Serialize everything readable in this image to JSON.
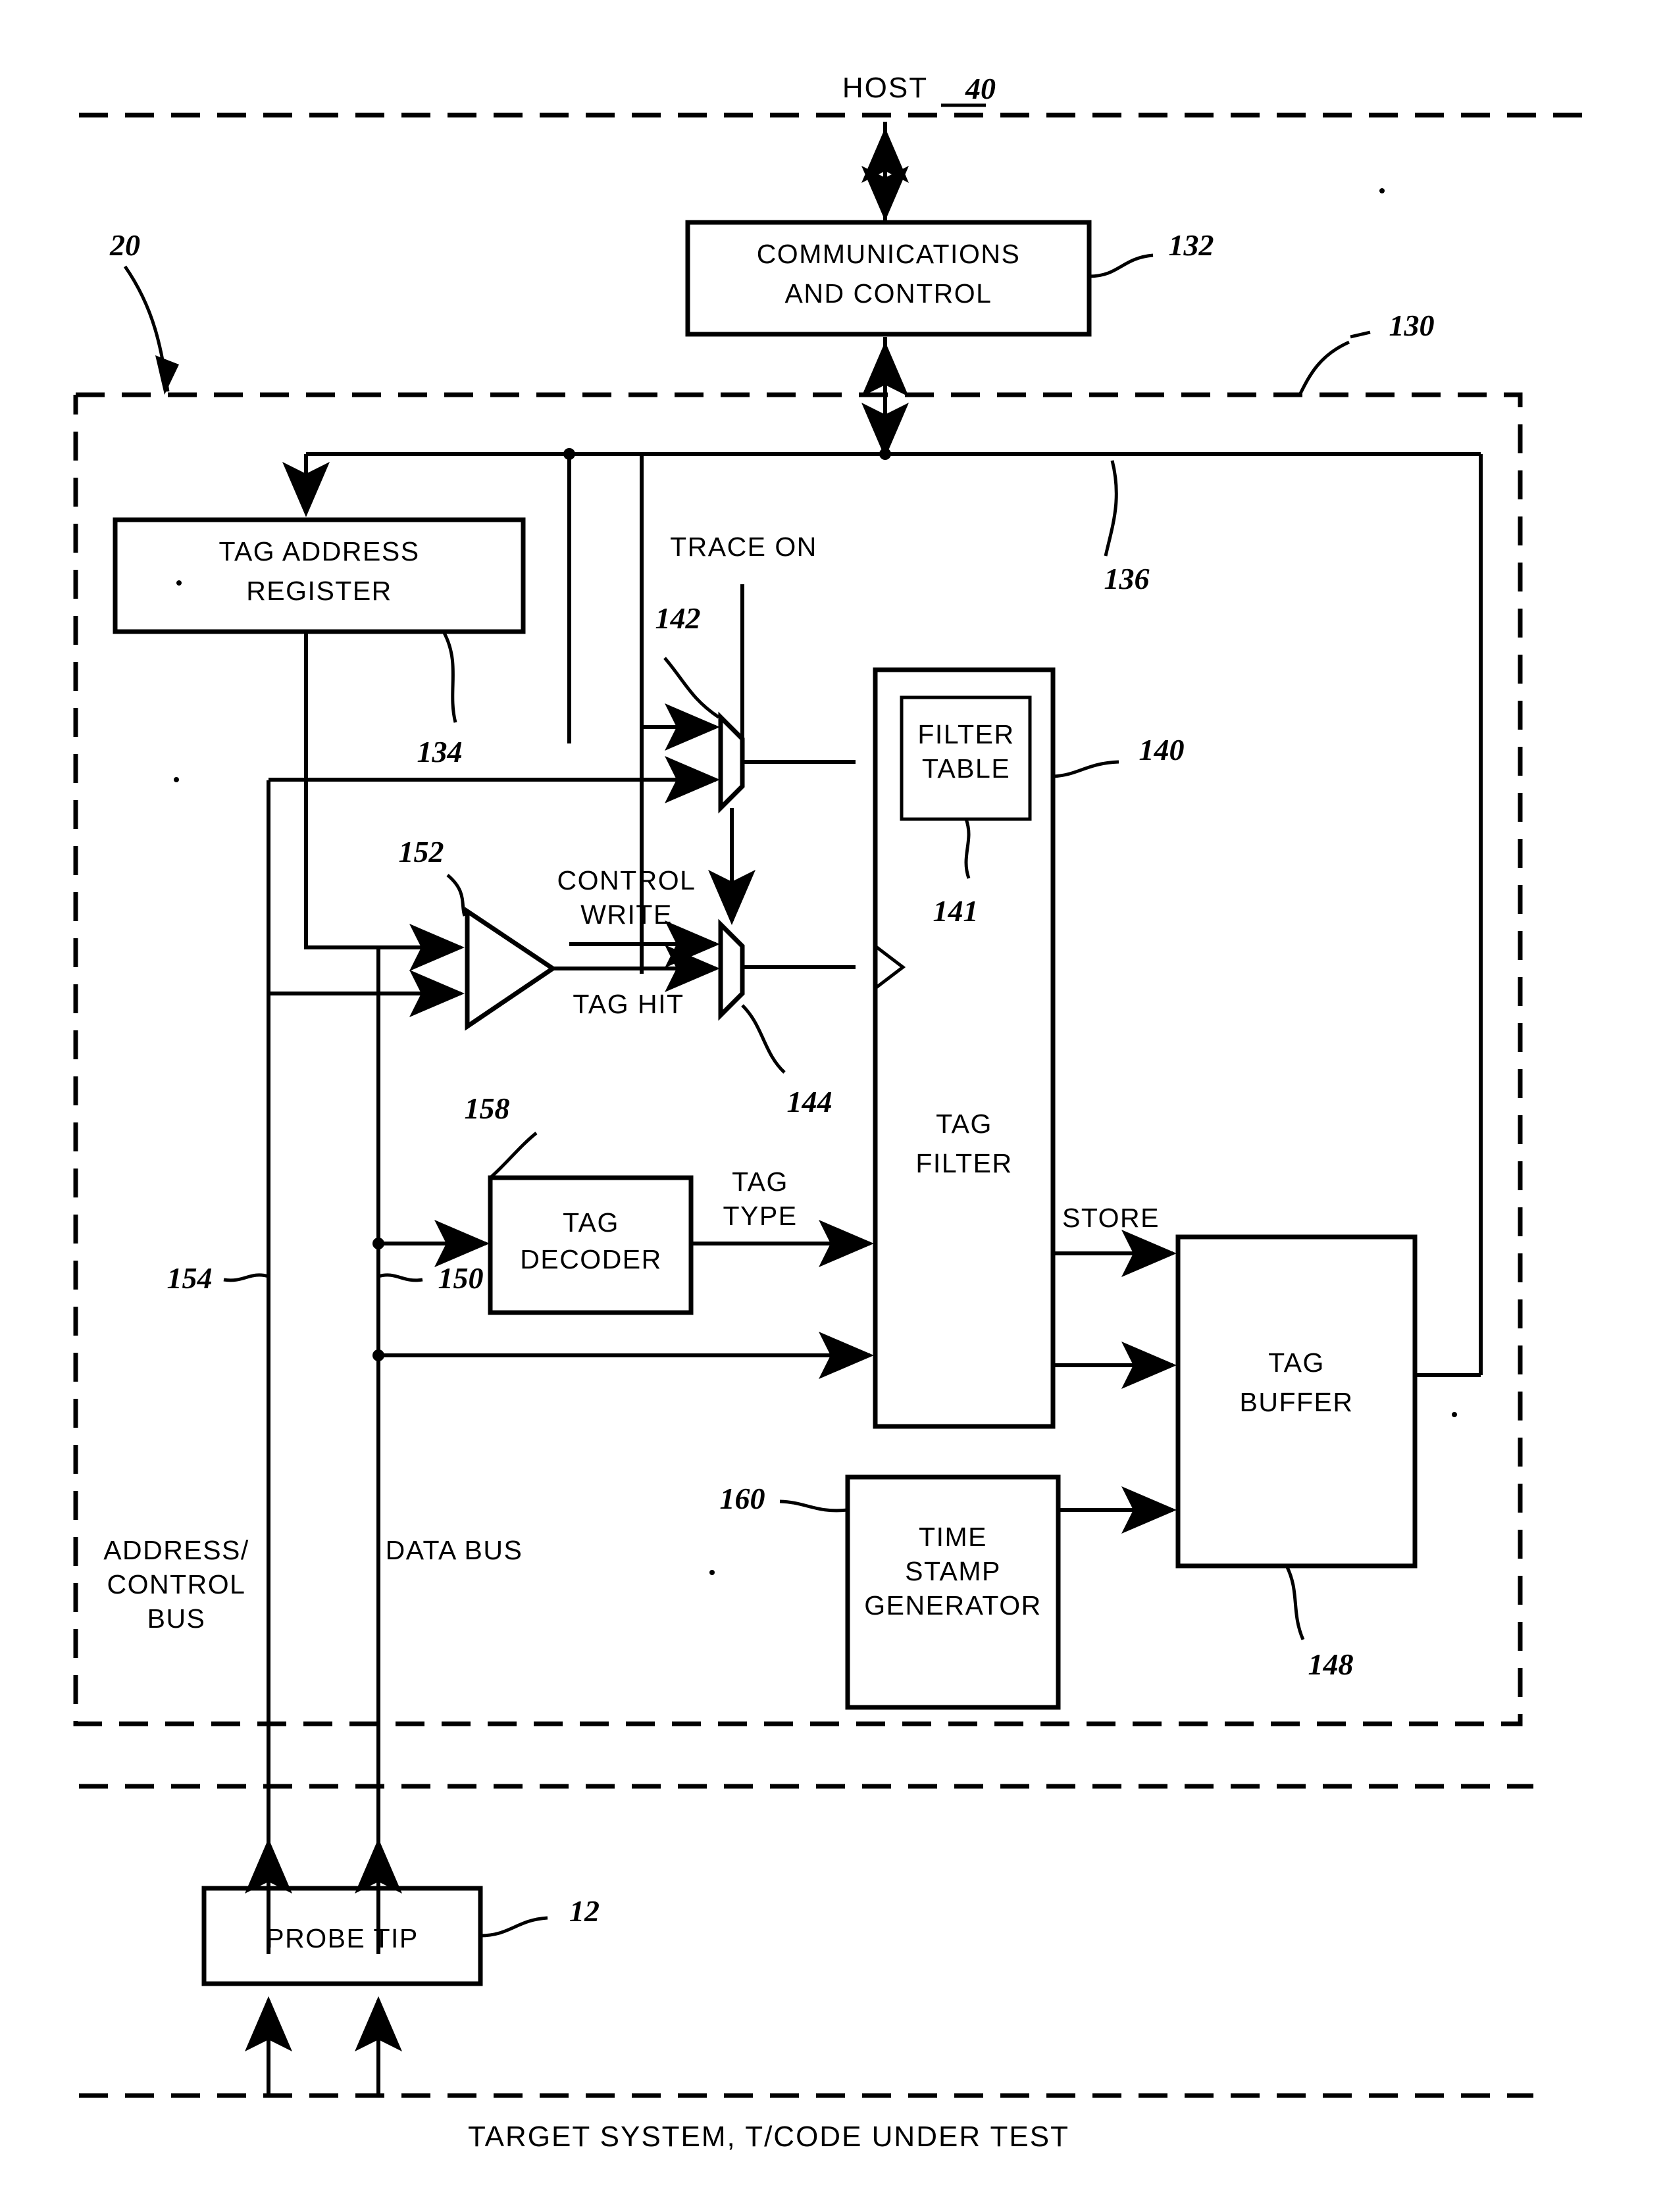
{
  "figure": {
    "host_label": "HOST",
    "host_ref": "40",
    "target_label": "TARGET SYSTEM, T/CODE UNDER TEST",
    "probe_ref_20": "20",
    "outer_ref_130": "130"
  },
  "blocks": {
    "comm_control": {
      "line1": "COMMUNICATIONS",
      "line2": "AND CONTROL",
      "ref": "132"
    },
    "tag_address_register": {
      "line1": "TAG ADDRESS",
      "line2": "REGISTER",
      "ref": "134"
    },
    "filter_table": {
      "line1": "FILTER",
      "line2": "TABLE",
      "ref": "141"
    },
    "tag_filter": {
      "line1": "TAG",
      "line2": "FILTER",
      "ref": "140"
    },
    "tag_decoder": {
      "line1": "TAG",
      "line2": "DECODER",
      "ref": "158"
    },
    "tag_buffer": {
      "line1": "TAG",
      "line2": "BUFFER",
      "ref": "148"
    },
    "time_stamp_generator": {
      "line1": "TIME",
      "line2": "STAMP",
      "line3": "GENERATOR",
      "ref": "160"
    },
    "probe_tip": {
      "line1": "PROBE TIP",
      "ref": "12"
    },
    "mux_trace": {
      "ref": "142"
    },
    "mux_taghit": {
      "ref": "144"
    },
    "comparator": {
      "ref": "152"
    }
  },
  "signals": {
    "trace_on": "TRACE ON",
    "control_write_l1": "CONTROL",
    "control_write_l2": "WRITE",
    "tag_hit": "TAG HIT",
    "tag_type_l1": "TAG",
    "tag_type_l2": "TYPE",
    "store": "STORE",
    "bus_136_ref": "136",
    "address_control_bus_l1": "ADDRESS/",
    "address_control_bus_l2": "CONTROL",
    "address_control_bus_l3": "BUS",
    "address_control_bus_ref": "154",
    "data_bus": "DATA BUS",
    "data_bus_ref": "150"
  },
  "colors": {
    "ink": "#000000",
    "paper": "#ffffff"
  }
}
